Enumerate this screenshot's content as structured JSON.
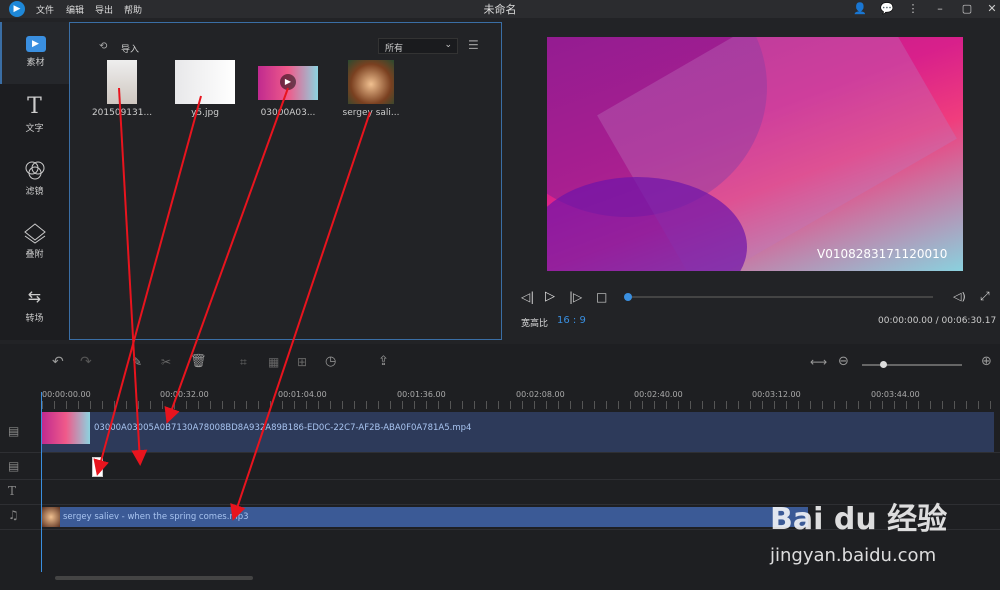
{
  "menu": {
    "file": "文件",
    "edit": "编辑",
    "export": "导出",
    "help": "帮助"
  },
  "window_title": "未命名",
  "sidebar": {
    "items": [
      {
        "label": "素材"
      },
      {
        "label": "文字"
      },
      {
        "label": "滤镜"
      },
      {
        "label": "叠附"
      },
      {
        "label": "转场"
      }
    ]
  },
  "media": {
    "import_label": "导入",
    "filter_value": "所有",
    "items": [
      {
        "name": "201509131..."
      },
      {
        "name": "y5.jpg"
      },
      {
        "name": "03000A03..."
      },
      {
        "name": "sergey sali..."
      }
    ]
  },
  "preview": {
    "watermark": "V0108283171120010",
    "aspect_label": "宽高比",
    "aspect_value": "16 : 9",
    "time": "00:00:00.00 / 00:06:30.17",
    "progress": 0
  },
  "timeline": {
    "ruler": [
      "00:00:00.00",
      "00:00:32.00",
      "00:01:04.00",
      "00:01:36.00",
      "00:02:08.00",
      "00:02:40.00",
      "00:03:12.00",
      "00:03:44.00"
    ],
    "video_clip": "03000A03005A0B7130A78008BD8A932A89B186-ED0C-22C7-AF2B-ABA0F0A781A5.mp4",
    "audio_clip": "sergey saliev - when the spring comes.mp3"
  },
  "watermark": {
    "brand": "Bai du 经验",
    "url": "jingyan.baidu.com"
  },
  "colors": {
    "accent": "#3a8fe0",
    "arrow": "#e8141e"
  }
}
